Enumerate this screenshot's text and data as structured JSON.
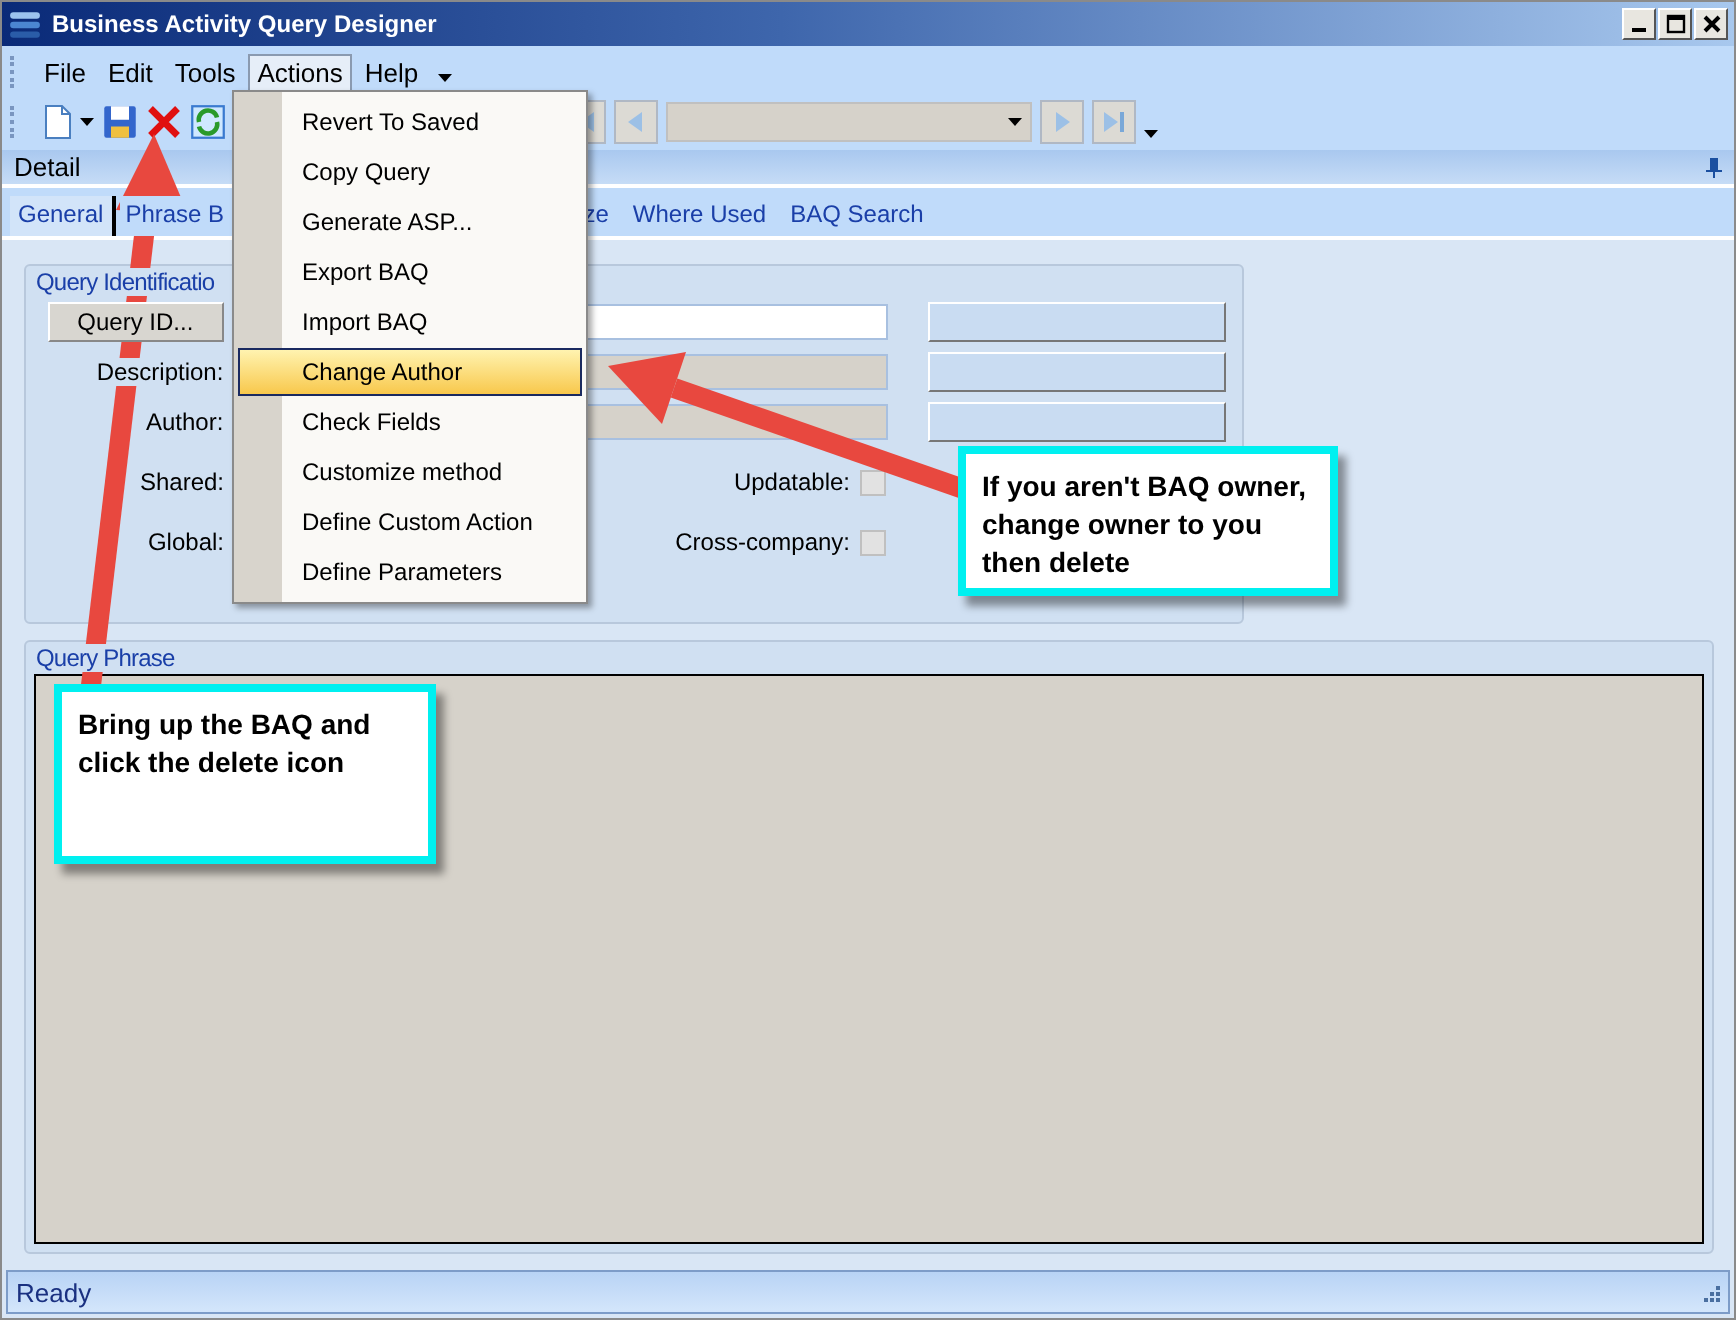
{
  "window": {
    "title": "Business Activity Query Designer"
  },
  "menu_bar": [
    {
      "label": "File",
      "selected": false
    },
    {
      "label": "Edit",
      "selected": false
    },
    {
      "label": "Tools",
      "selected": false
    },
    {
      "label": "Actions",
      "selected": true
    },
    {
      "label": "Help",
      "selected": false
    }
  ],
  "actions_menu": [
    {
      "label": "Revert To Saved",
      "highlighted": false
    },
    {
      "label": "Copy Query",
      "highlighted": false
    },
    {
      "label": "Generate ASP...",
      "highlighted": false
    },
    {
      "label": "Export BAQ",
      "highlighted": false
    },
    {
      "label": "Import BAQ",
      "highlighted": false
    },
    {
      "label": "Change Author",
      "highlighted": true
    },
    {
      "label": "Check Fields",
      "highlighted": false
    },
    {
      "label": "Customize method",
      "highlighted": false
    },
    {
      "label": "Define Custom Action",
      "highlighted": false
    },
    {
      "label": "Define Parameters",
      "highlighted": false
    }
  ],
  "panel": {
    "title": "Detail"
  },
  "tabs": [
    {
      "label": "General",
      "selected": true
    },
    {
      "label": "Phrase B",
      "selected": false
    },
    {
      "label": "ze",
      "selected": false
    },
    {
      "label": "Where Used",
      "selected": false
    },
    {
      "label": "BAQ Search",
      "selected": false
    }
  ],
  "query_identification": {
    "title": "Query Identificatio",
    "rows": [
      {
        "kind": "button",
        "label": "Query ID...",
        "disabled": false
      },
      {
        "kind": "field",
        "label": "Description:",
        "disabled": true
      },
      {
        "kind": "field",
        "label": "Author:",
        "disabled": true
      }
    ],
    "flags": [
      {
        "label": "Shared:",
        "option": "Updatable:",
        "checked": false
      },
      {
        "label": "Global:",
        "option": "Cross-company:",
        "checked": false
      }
    ]
  },
  "query_phrase": {
    "title": "Query Phrase"
  },
  "callouts": [
    "If you aren't BAQ owner, change owner to you then delete",
    "Bring up the BAQ and click the delete icon"
  ],
  "status_bar": "Ready"
}
